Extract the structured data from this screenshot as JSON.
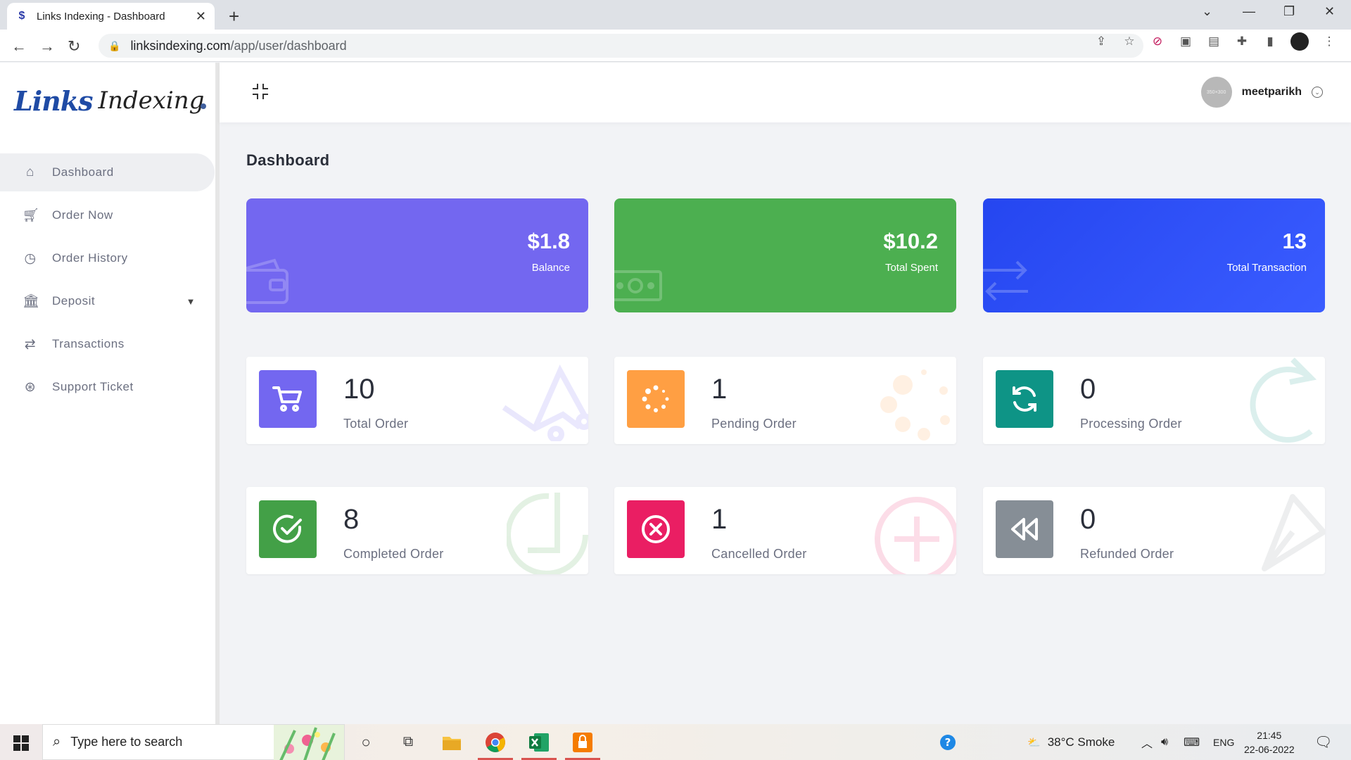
{
  "browser": {
    "tab_title": "Links Indexing - Dashboard",
    "url_host": "linksindexing.com",
    "url_path": "/app/user/dashboard"
  },
  "app": {
    "logo_text_1": "Links",
    "logo_text_2": "Indexing",
    "page_title": "Dashboard",
    "user": {
      "name": "meetparikh",
      "avatar_text": "350×300"
    }
  },
  "sidebar": {
    "items": [
      {
        "label": "Dashboard",
        "icon": "home-icon",
        "active": true
      },
      {
        "label": "Order Now",
        "icon": "cart-icon"
      },
      {
        "label": "Order History",
        "icon": "clock-icon"
      },
      {
        "label": "Deposit",
        "icon": "bank-icon",
        "has_submenu": true
      },
      {
        "label": "Transactions",
        "icon": "transfer-icon"
      },
      {
        "label": "Support Ticket",
        "icon": "lifebuoy-icon"
      }
    ]
  },
  "stats": [
    {
      "value": "$1.8",
      "label": "Balance",
      "color": "#7367f0",
      "icon": "wallet-icon"
    },
    {
      "value": "$10.2",
      "label": "Total Spent",
      "color": "#4caf50",
      "icon": "money-icon"
    },
    {
      "value": "13",
      "label": "Total Transaction",
      "color": "#2f55ff",
      "icon": "transfer-icon"
    }
  ],
  "orders": [
    {
      "value": "10",
      "label": "Total Order",
      "color": "#7367f0",
      "icon": "cart-icon"
    },
    {
      "value": "1",
      "label": "Pending Order",
      "color": "#ff9f43",
      "icon": "spinner-icon"
    },
    {
      "value": "0",
      "label": "Processing Order",
      "color": "#0e9486",
      "icon": "refresh-icon"
    },
    {
      "value": "8",
      "label": "Completed Order",
      "color": "#43a047",
      "icon": "check-circle-icon"
    },
    {
      "value": "1",
      "label": "Cancelled Order",
      "color": "#ea1e63",
      "icon": "x-circle-icon"
    },
    {
      "value": "0",
      "label": "Refunded Order",
      "color": "#868e96",
      "icon": "rewind-icon"
    }
  ],
  "taskbar": {
    "search_placeholder": "Type here to search",
    "weather": "38°C  Smoke",
    "language": "ENG",
    "time": "21:45",
    "date": "22-06-2022"
  }
}
